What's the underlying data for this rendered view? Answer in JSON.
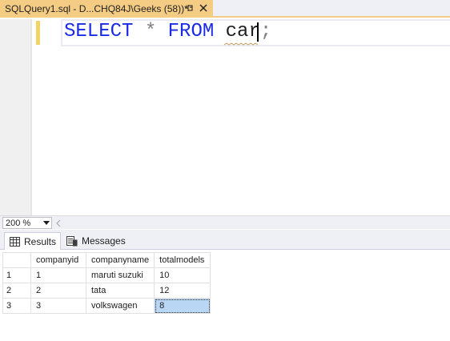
{
  "document_tab": {
    "title": "SQLQuery1.sql - D...CHQ84J\\Geeks (58))*",
    "pin_icon": "pin-icon",
    "close_icon": "close-icon"
  },
  "editor": {
    "tokens": {
      "select": "SELECT",
      "star": "*",
      "from": "FROM",
      "table": "car",
      "semicolon": ";"
    },
    "keyword_color": "#1a2be6",
    "squiggle_color": "#c8a064"
  },
  "zoom": {
    "value": "200 %"
  },
  "results_tabs": [
    {
      "label": "Results",
      "icon": "grid-icon"
    },
    {
      "label": "Messages",
      "icon": "messages-icon"
    }
  ],
  "grid": {
    "columns": [
      "companyid",
      "companyname",
      "totalmodels"
    ],
    "rows": [
      {
        "rownum": "1",
        "cells": [
          "1",
          "maruti  suzuki",
          "10"
        ]
      },
      {
        "rownum": "2",
        "cells": [
          "2",
          "tata",
          "12"
        ]
      },
      {
        "rownum": "3",
        "cells": [
          "3",
          "volkswagen",
          "8"
        ]
      }
    ],
    "selected_cell": {
      "row": 3,
      "column": "totalmodels"
    },
    "selection_color": "#b9d6f5"
  }
}
